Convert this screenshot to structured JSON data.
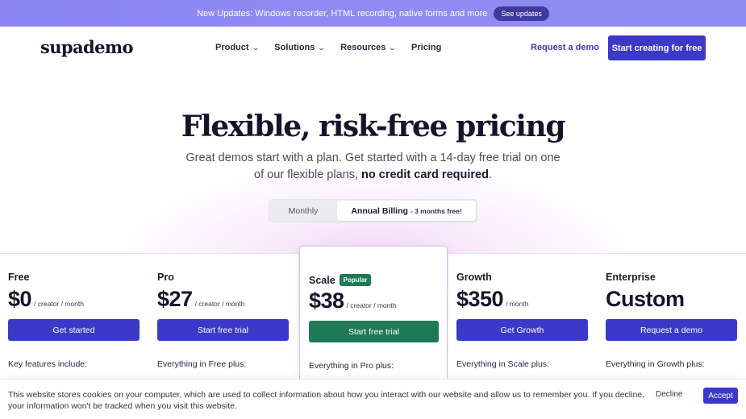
{
  "announcement": {
    "text": "New Updates: Windows recorder, HTML recording, native forms and more",
    "button": "See updates"
  },
  "nav": {
    "logo": "supademo",
    "menu": [
      {
        "label": "Product",
        "dropdown": true
      },
      {
        "label": "Solutions",
        "dropdown": true
      },
      {
        "label": "Resources",
        "dropdown": true
      },
      {
        "label": "Pricing",
        "dropdown": false
      }
    ],
    "request_demo": "Request a demo",
    "cta": "Start creating for free"
  },
  "hero": {
    "title": "Flexible, risk-free pricing",
    "subtitle_lead": "Great demos start with a plan. Get started with a 14-day free trial on one of our flexible plans,",
    "subtitle_bold": "no credit card required",
    "subtitle_end": "."
  },
  "billing_toggle": {
    "monthly": "Monthly",
    "annual": "Annual Billing",
    "annual_promo": "- 3 months free!",
    "selected": "annual"
  },
  "plans": [
    {
      "name": "Free",
      "price": "$0",
      "period": "/ creator / month",
      "button": "Get started",
      "features_heading": "Key features include:"
    },
    {
      "name": "Pro",
      "price": "$27",
      "period": "/ creator / month",
      "button": "Start free trial",
      "features_heading": "Everything in Free plus:"
    },
    {
      "name": "Scale",
      "badge": "Popular",
      "price": "$38",
      "period": "/ creator / month",
      "button": "Start free trial",
      "features_heading": "Everything in Pro plus:"
    },
    {
      "name": "Growth",
      "price": "$350",
      "period": "/ month",
      "button": "Get Growth",
      "features_heading": "Everything in Scale plus:"
    },
    {
      "name": "Enterprise",
      "price": "Custom",
      "period": "",
      "button": "Request a demo",
      "features_heading": "Everything in Growth plus:"
    }
  ],
  "cookie_banner": {
    "text": "This website stores cookies on your computer, which are used to collect information about how you interact with our website and allow us to remember you. If you decline, your information won't be tracked when you visit this website.",
    "decline": "Decline",
    "accept": "Accept"
  },
  "colors": {
    "primary": "#3c39c9",
    "featured": "#1e7a54",
    "announcement_bg": "#8a85f0"
  }
}
